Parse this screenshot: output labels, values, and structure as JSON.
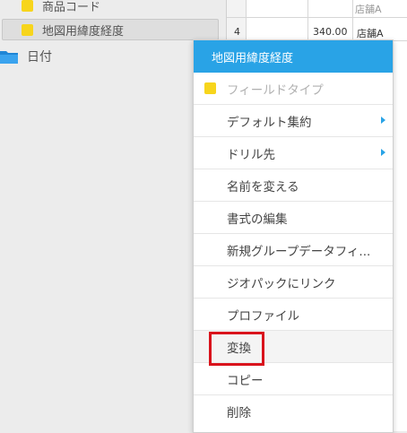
{
  "fields": {
    "item1": "商品コード",
    "item2": "地図用緯度経度",
    "folder": "日付"
  },
  "grid": {
    "row_number": "4",
    "value": "340.00",
    "store": "店舗A",
    "top_partial": "店舗A"
  },
  "context_menu": {
    "title": "地図用緯度経度",
    "items": [
      {
        "label": "フィールドタイプ"
      },
      {
        "label": "デフォルト集約"
      },
      {
        "label": "ドリル先"
      },
      {
        "label": "名前を変える"
      },
      {
        "label": "書式の編集"
      },
      {
        "label": "新規グループデータフィ..."
      },
      {
        "label": "ジオパックにリンク"
      },
      {
        "label": "プロファイル"
      },
      {
        "label": "変換"
      },
      {
        "label": "コピー"
      },
      {
        "label": "削除"
      }
    ]
  },
  "colors": {
    "accent": "#29a3e6",
    "field_marker": "#f7d51c",
    "highlight": "#d9131c"
  },
  "icons": {
    "field_marker": "yellow-square-icon",
    "folder": "folder-icon",
    "submenu": "chevron-right-icon"
  }
}
